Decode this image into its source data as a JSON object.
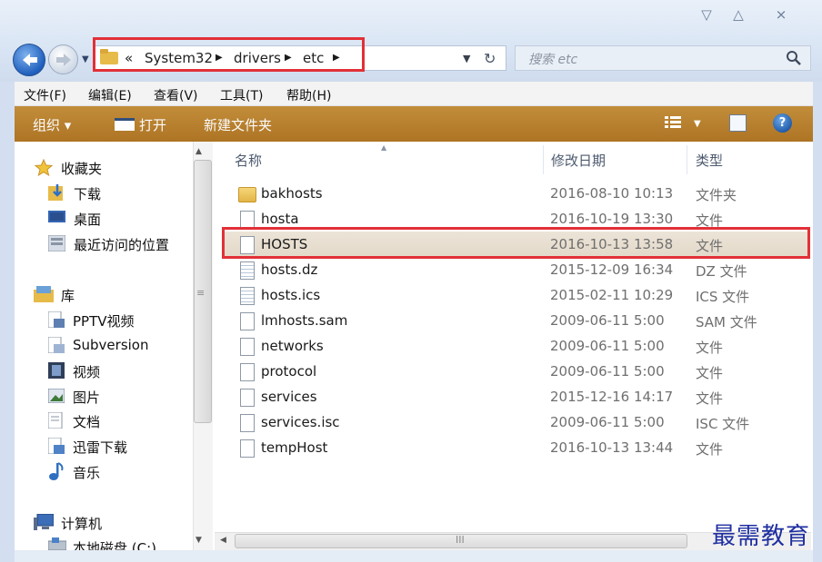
{
  "window": {
    "minimize_glyph": "▽",
    "maximize_glyph": "△",
    "close_glyph": "⨯"
  },
  "address": {
    "crumbs": [
      "«",
      "System32",
      "drivers",
      "etc"
    ],
    "arrow": "▶",
    "dropdown_glyph": "▼",
    "refresh_glyph": "↻"
  },
  "search": {
    "placeholder": "搜索 etc"
  },
  "menu": [
    "文件(F)",
    "编辑(E)",
    "查看(V)",
    "工具(T)",
    "帮助(H)"
  ],
  "toolbar": {
    "organize_label": "组织 ▾",
    "open_label": "打开",
    "new_folder_label": "新建文件夹",
    "help_glyph": "?"
  },
  "nav": {
    "favorites": "收藏夹",
    "favorites_items": [
      "下载",
      "桌面",
      "最近访问的位置"
    ],
    "library": "库",
    "library_items": [
      "PPTV视频",
      "Subversion",
      "视频",
      "图片",
      "文档",
      "迅雷下载",
      "音乐"
    ],
    "computer": "计算机",
    "drive": "本地磁盘 (C:)"
  },
  "columns": {
    "name": "名称",
    "date": "修改日期",
    "type": "类型"
  },
  "files": [
    {
      "name": "bakhosts",
      "date": "2016-08-10 10:13",
      "type": "文件夹",
      "icon": "folder"
    },
    {
      "name": "hosta",
      "date": "2016-10-19 13:30",
      "type": "文件",
      "icon": "file"
    },
    {
      "name": "HOSTS",
      "date": "2016-10-13 13:58",
      "type": "文件",
      "icon": "file"
    },
    {
      "name": "hosts.dz",
      "date": "2015-12-09 16:34",
      "type": "DZ 文件",
      "icon": "doc"
    },
    {
      "name": "hosts.ics",
      "date": "2015-02-11 10:29",
      "type": "ICS 文件",
      "icon": "doc"
    },
    {
      "name": "lmhosts.sam",
      "date": "2009-06-11 5:00",
      "type": "SAM 文件",
      "icon": "file"
    },
    {
      "name": "networks",
      "date": "2009-06-11 5:00",
      "type": "文件",
      "icon": "file"
    },
    {
      "name": "protocol",
      "date": "2009-06-11 5:00",
      "type": "文件",
      "icon": "file"
    },
    {
      "name": "services",
      "date": "2015-12-16 14:17",
      "type": "文件",
      "icon": "file"
    },
    {
      "name": "services.isc",
      "date": "2009-06-11 5:00",
      "type": "ISC 文件",
      "icon": "file"
    },
    {
      "name": "tempHost",
      "date": "2016-10-13 13:44",
      "type": "文件",
      "icon": "file"
    }
  ],
  "selected_file": "HOSTS",
  "colors": {
    "highlight_border": "#e23038",
    "toolbar": "#b67d2c"
  },
  "watermark": "最需教育"
}
